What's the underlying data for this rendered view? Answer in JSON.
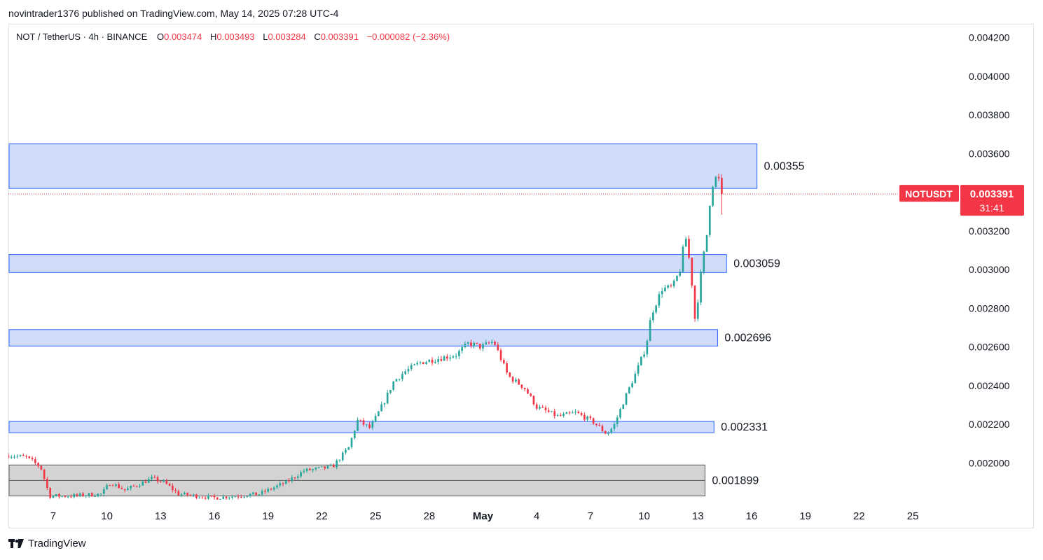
{
  "publish_line": "novintrader1376 published on TradingView.com, May 14, 2025 07:28 UTC-4",
  "legend": {
    "symbol": "NOT / TetherUS · 4h · BINANCE",
    "o_label": "O",
    "o_value": "0.003474",
    "h_label": "H",
    "h_value": "0.003493",
    "l_label": "L",
    "l_value": "0.003284",
    "c_label": "C",
    "c_value": "0.003391",
    "change": "−0.000082 (−2.36%)"
  },
  "price_badge": {
    "symbol": "NOTUSDT",
    "price": "0.003391",
    "countdown": "31:41"
  },
  "footer": {
    "brand": "TradingView",
    "logo_icon": "tradingview-logo-icon"
  },
  "colors": {
    "up": "#26a69a",
    "down": "#f23645",
    "zone_fill": "#d1dcfc",
    "zone_border": "#2962ff",
    "gray_zone": "#d3d3d3"
  },
  "chart_data": {
    "type": "candlestick",
    "title": "NOT / TetherUS · 4h · BINANCE",
    "ylim": [
      0.00181,
      0.00426
    ],
    "y_ticks": [
      "0.004200",
      "0.004000",
      "0.003800",
      "0.003600",
      "0.003200",
      "0.003000",
      "0.002800",
      "0.002600",
      "0.002400",
      "0.002200",
      "0.002000"
    ],
    "y_tick_values": [
      0.0042,
      0.004,
      0.0038,
      0.0036,
      0.0032,
      0.003,
      0.0028,
      0.0026,
      0.0024,
      0.0022,
      0.002
    ],
    "x_ticks": [
      "7",
      "10",
      "13",
      "16",
      "19",
      "22",
      "25",
      "28",
      "May",
      "4",
      "7",
      "10",
      "13",
      "16",
      "19",
      "22",
      "25"
    ],
    "x_tick_days": [
      7,
      10,
      13,
      16,
      19,
      22,
      25,
      28,
      31,
      34,
      37,
      40,
      43,
      46,
      49,
      52,
      55
    ],
    "x_range_days": [
      4.5,
      57.5
    ],
    "last_price": 0.003391,
    "zones": [
      {
        "label": "0.00355",
        "top": 0.00365,
        "bottom": 0.00342,
        "end_day": 46.3,
        "style": "blue"
      },
      {
        "label": "0.003059",
        "top": 0.003078,
        "bottom": 0.002985,
        "end_day": 44.6,
        "style": "blue"
      },
      {
        "label": "0.002696",
        "top": 0.00269,
        "bottom": 0.002605,
        "end_day": 44.1,
        "style": "blue"
      },
      {
        "label": "0.002331",
        "top": 0.002215,
        "bottom": 0.002157,
        "end_day": 43.9,
        "style": "blue"
      },
      {
        "label": "0.001899",
        "top": 0.00199,
        "bottom": 0.00183,
        "end_day": 43.4,
        "style": "gray"
      }
    ],
    "waypoints": [
      [
        4.5,
        0.00204
      ],
      [
        5.5,
        0.00203
      ],
      [
        6.3,
        0.00198
      ],
      [
        6.8,
        0.00183
      ],
      [
        8.0,
        0.00183
      ],
      [
        9.7,
        0.00184
      ],
      [
        10.2,
        0.0019
      ],
      [
        11.0,
        0.00186
      ],
      [
        12.5,
        0.00192
      ],
      [
        13.2,
        0.0019
      ],
      [
        14.0,
        0.00184
      ],
      [
        16.0,
        0.00182
      ],
      [
        18.5,
        0.00184
      ],
      [
        20.0,
        0.0019
      ],
      [
        21.0,
        0.00196
      ],
      [
        22.6,
        0.00198
      ],
      [
        23.5,
        0.00208
      ],
      [
        24.0,
        0.00222
      ],
      [
        24.7,
        0.00218
      ],
      [
        25.5,
        0.00232
      ],
      [
        26.0,
        0.00242
      ],
      [
        26.6,
        0.00247
      ],
      [
        27.5,
        0.00252
      ],
      [
        28.5,
        0.00254
      ],
      [
        29.5,
        0.00256
      ],
      [
        30.2,
        0.00262
      ],
      [
        30.9,
        0.0026
      ],
      [
        31.6,
        0.00263
      ],
      [
        32.0,
        0.00254
      ],
      [
        32.4,
        0.00245
      ],
      [
        33.3,
        0.00239
      ],
      [
        34.0,
        0.00229
      ],
      [
        35.2,
        0.00224
      ],
      [
        36.2,
        0.00226
      ],
      [
        37.2,
        0.00221
      ],
      [
        37.9,
        0.00215
      ],
      [
        38.3,
        0.00219
      ],
      [
        38.9,
        0.00233
      ],
      [
        39.6,
        0.00248
      ],
      [
        40.1,
        0.0026
      ],
      [
        40.4,
        0.00277
      ],
      [
        41.0,
        0.0029
      ],
      [
        41.6,
        0.00291
      ],
      [
        42.0,
        0.003
      ],
      [
        42.3,
        0.00318
      ],
      [
        42.6,
        0.003
      ],
      [
        42.85,
        0.00273
      ],
      [
        43.2,
        0.003
      ],
      [
        43.5,
        0.00318
      ],
      [
        43.75,
        0.00343
      ],
      [
        44.1,
        0.00349
      ],
      [
        44.35,
        0.003391
      ]
    ]
  }
}
